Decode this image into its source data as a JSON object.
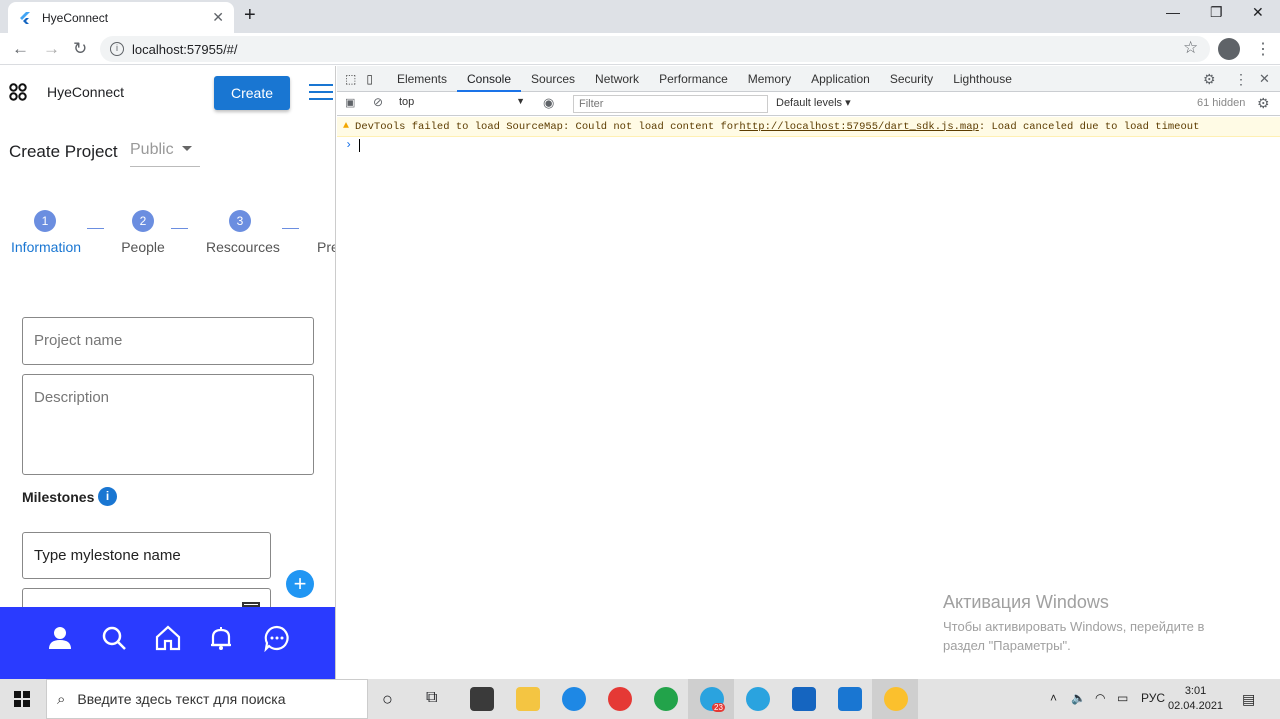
{
  "browser": {
    "tab_title": "HyeConnect",
    "url": "localhost:57955/#/"
  },
  "app": {
    "brand": "HyeConnect",
    "create_label": "Create",
    "page_title": "Create Project",
    "visibility": "Public",
    "steps": [
      {
        "number": "1",
        "label": "Information"
      },
      {
        "number": "2",
        "label": "People"
      },
      {
        "number": "3",
        "label": "Rescources"
      },
      {
        "number": "",
        "label": "Pre"
      }
    ],
    "project_name_placeholder": "Project name",
    "description_placeholder": "Description",
    "milestones_label": "Milestones",
    "milestone_value": "Type mylestone name",
    "add_label": "+"
  },
  "devtools": {
    "tabs": [
      "Elements",
      "Console",
      "Sources",
      "Network",
      "Performance",
      "Memory",
      "Application",
      "Security",
      "Lighthouse"
    ],
    "active_tab": "Console",
    "context": "top",
    "filter_placeholder": "Filter",
    "levels": "Default levels ▾",
    "hidden": "61 hidden",
    "warning_prefix": "DevTools failed to load SourceMap: Could not load content for ",
    "warning_link": "http://localhost:57955/dart_sdk.js.map",
    "warning_suffix": ": Load canceled due to load timeout",
    "prompt": "›"
  },
  "watermark": {
    "line1": "Активация Windows",
    "line2": "Чтобы активировать Windows, перейдите в",
    "line3": "раздел \"Параметры\"."
  },
  "taskbar": {
    "search_placeholder": "Введите здесь текст для поиска",
    "lang": "РУС",
    "time": "3:01",
    "date": "02.04.2021",
    "telegram_badge": "23"
  },
  "colors": {
    "accent": "#1976d2",
    "bottom_nav": "#2a3bff",
    "step": "#6b8ee0"
  }
}
